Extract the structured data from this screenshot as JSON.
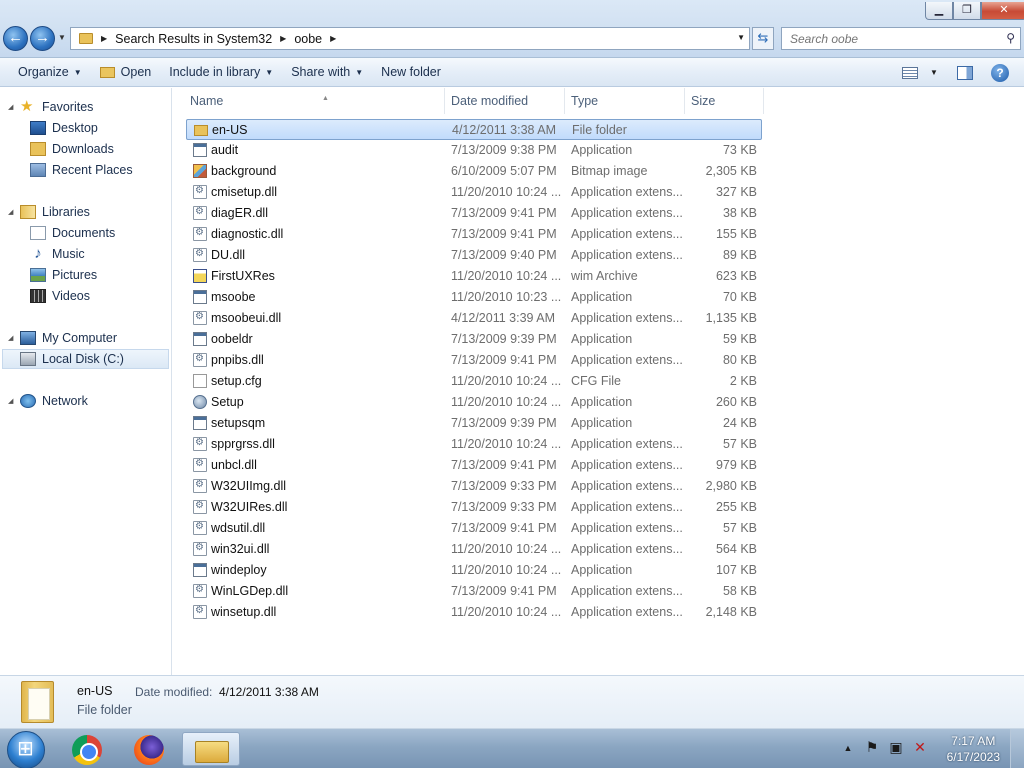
{
  "window": {
    "minimize": "▁",
    "maximize": "❐",
    "close": "✕"
  },
  "nav": {
    "back_icon": "←",
    "forward_icon": "→"
  },
  "address": {
    "segments": [
      "Search Results in System32",
      "oobe"
    ]
  },
  "search": {
    "placeholder": "Search oobe"
  },
  "toolbar": {
    "organize": "Organize",
    "open": "Open",
    "include_in_library": "Include in library",
    "share_with": "Share with",
    "new_folder": "New folder",
    "help": "?"
  },
  "sidebar": {
    "favorites": "Favorites",
    "desktop": "Desktop",
    "downloads": "Downloads",
    "recent_places": "Recent Places",
    "libraries": "Libraries",
    "documents": "Documents",
    "music": "Music",
    "pictures": "Pictures",
    "videos": "Videos",
    "my_computer": "My Computer",
    "local_disk": "Local Disk (C:)",
    "network": "Network"
  },
  "columns": {
    "name": "Name",
    "date_modified": "Date modified",
    "type": "Type",
    "size": "Size"
  },
  "files": [
    {
      "name": "en-US",
      "date": "4/12/2011 3:38 AM",
      "type": "File folder",
      "size": "",
      "icon": "folder-icon"
    },
    {
      "name": "audit",
      "date": "7/13/2009 9:38 PM",
      "type": "Application",
      "size": "73 KB",
      "icon": "application-icon"
    },
    {
      "name": "background",
      "date": "6/10/2009 5:07 PM",
      "type": "Bitmap image",
      "size": "2,305 KB",
      "icon": "bitmap-icon"
    },
    {
      "name": "cmisetup.dll",
      "date": "11/20/2010 10:24 ...",
      "type": "Application extens...",
      "size": "327 KB",
      "icon": "dll-icon"
    },
    {
      "name": "diagER.dll",
      "date": "7/13/2009 9:41 PM",
      "type": "Application extens...",
      "size": "38 KB",
      "icon": "dll-icon"
    },
    {
      "name": "diagnostic.dll",
      "date": "7/13/2009 9:41 PM",
      "type": "Application extens...",
      "size": "155 KB",
      "icon": "dll-icon"
    },
    {
      "name": "DU.dll",
      "date": "7/13/2009 9:40 PM",
      "type": "Application extens...",
      "size": "89 KB",
      "icon": "dll-icon"
    },
    {
      "name": "FirstUXRes",
      "date": "11/20/2010 10:24 ...",
      "type": "wim Archive",
      "size": "623 KB",
      "icon": "wim-icon"
    },
    {
      "name": "msoobe",
      "date": "11/20/2010 10:23 ...",
      "type": "Application",
      "size": "70 KB",
      "icon": "application-icon"
    },
    {
      "name": "msoobeui.dll",
      "date": "4/12/2011 3:39 AM",
      "type": "Application extens...",
      "size": "1,135 KB",
      "icon": "dll-icon"
    },
    {
      "name": "oobeldr",
      "date": "7/13/2009 9:39 PM",
      "type": "Application",
      "size": "59 KB",
      "icon": "application-icon"
    },
    {
      "name": "pnpibs.dll",
      "date": "7/13/2009 9:41 PM",
      "type": "Application extens...",
      "size": "80 KB",
      "icon": "dll-icon"
    },
    {
      "name": "setup.cfg",
      "date": "11/20/2010 10:24 ...",
      "type": "CFG File",
      "size": "2 KB",
      "icon": "cfg-icon"
    },
    {
      "name": "Setup",
      "date": "11/20/2010 10:24 ...",
      "type": "Application",
      "size": "260 KB",
      "icon": "setup-icon"
    },
    {
      "name": "setupsqm",
      "date": "7/13/2009 9:39 PM",
      "type": "Application",
      "size": "24 KB",
      "icon": "application-icon"
    },
    {
      "name": "spprgrss.dll",
      "date": "11/20/2010 10:24 ...",
      "type": "Application extens...",
      "size": "57 KB",
      "icon": "dll-icon"
    },
    {
      "name": "unbcl.dll",
      "date": "7/13/2009 9:41 PM",
      "type": "Application extens...",
      "size": "979 KB",
      "icon": "dll-icon"
    },
    {
      "name": "W32UIImg.dll",
      "date": "7/13/2009 9:33 PM",
      "type": "Application extens...",
      "size": "2,980 KB",
      "icon": "dll-icon"
    },
    {
      "name": "W32UIRes.dll",
      "date": "7/13/2009 9:33 PM",
      "type": "Application extens...",
      "size": "255 KB",
      "icon": "dll-icon"
    },
    {
      "name": "wdsutil.dll",
      "date": "7/13/2009 9:41 PM",
      "type": "Application extens...",
      "size": "57 KB",
      "icon": "dll-icon"
    },
    {
      "name": "win32ui.dll",
      "date": "11/20/2010 10:24 ...",
      "type": "Application extens...",
      "size": "564 KB",
      "icon": "dll-icon"
    },
    {
      "name": "windeploy",
      "date": "11/20/2010 10:24 ...",
      "type": "Application",
      "size": "107 KB",
      "icon": "application-icon"
    },
    {
      "name": "WinLGDep.dll",
      "date": "7/13/2009 9:41 PM",
      "type": "Application extens...",
      "size": "58 KB",
      "icon": "dll-icon"
    },
    {
      "name": "winsetup.dll",
      "date": "11/20/2010 10:24 ...",
      "type": "Application extens...",
      "size": "2,148 KB",
      "icon": "dll-icon"
    }
  ],
  "selected_index": 0,
  "details": {
    "name": "en-US",
    "date_label": "Date modified:",
    "date": "4/12/2011 3:38 AM",
    "type": "File folder"
  },
  "taskbar": {
    "apps": [
      "chrome-icon",
      "firefox-icon",
      "explorer-icon"
    ],
    "time": "7:17 AM",
    "date": "6/17/2023",
    "tray_icons": [
      "show-hidden-icons",
      "action-center-flag-icon",
      "network-icon",
      "volume-muted-icon"
    ]
  }
}
